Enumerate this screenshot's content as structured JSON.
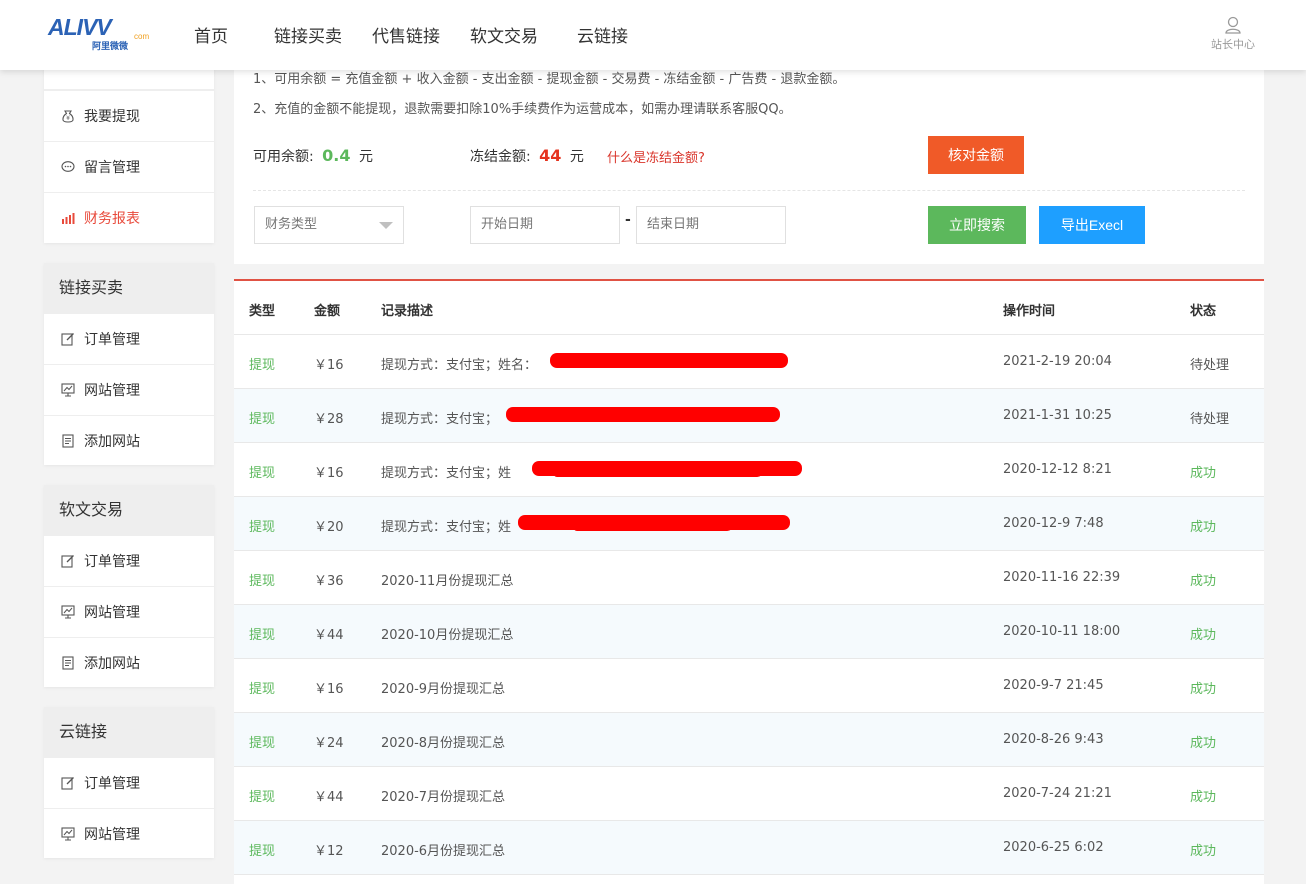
{
  "header": {
    "logo_text": "ALIVV",
    "logo_suffix": "com",
    "logo_cn": "阿里微微",
    "nav": [
      "首页",
      "链接买卖",
      "代售链接",
      "软文交易",
      "云链接"
    ],
    "user_label": "站长中心"
  },
  "sidebar": {
    "card1_items": [
      "我要提现",
      "留言管理",
      "财务报表"
    ],
    "groups": [
      {
        "title": "链接买卖",
        "items": [
          "订单管理",
          "网站管理",
          "添加网站"
        ]
      },
      {
        "title": "软文交易",
        "items": [
          "订单管理",
          "网站管理",
          "添加网站"
        ]
      },
      {
        "title": "云链接",
        "items": [
          "订单管理",
          "网站管理"
        ]
      }
    ]
  },
  "panel": {
    "note1": "1、可用余额 = 充值金额 + 收入金额 - 支出金额 - 提现金额 - 交易费 - 冻结金额 - 广告费 - 退款金额。",
    "note2": "2、充值的金额不能提现，退款需要扣除10%手续费作为运营成本，如需办理请联系客服QQ。",
    "available_label": "可用余额:",
    "available_value": "0.4",
    "frozen_label": "冻结金额:",
    "frozen_value": "44",
    "unit": "元",
    "frozen_link": "什么是冻结金额?",
    "check_button": "核对金额",
    "type_select": "财务类型",
    "start_date_placeholder": "开始日期",
    "end_date_placeholder": "结束日期",
    "date_separator": "-",
    "search_button": "立即搜索",
    "export_button": "导出Execl"
  },
  "table": {
    "headers": [
      "类型",
      "金额",
      "记录描述",
      "操作时间",
      "状态"
    ],
    "rows": [
      {
        "type": "提现",
        "amount": "￥16",
        "desc": "提现方式：支付宝；姓名：",
        "time": "2021-2-19 20:04",
        "status": "待处理"
      },
      {
        "type": "提现",
        "amount": "￥28",
        "desc": "提现方式：支付宝；",
        "time": "2021-1-31 10:25",
        "status": "待处理"
      },
      {
        "type": "提现",
        "amount": "￥16",
        "desc": "提现方式：支付宝；姓",
        "time": "2020-12-12 8:21",
        "status": "成功"
      },
      {
        "type": "提现",
        "amount": "￥20",
        "desc": "提现方式：支付宝；姓",
        "time": "2020-12-9 7:48",
        "status": "成功"
      },
      {
        "type": "提现",
        "amount": "￥36",
        "desc": "2020-11月份提现汇总",
        "time": "2020-11-16 22:39",
        "status": "成功"
      },
      {
        "type": "提现",
        "amount": "￥44",
        "desc": "2020-10月份提现汇总",
        "time": "2020-10-11 18:00",
        "status": "成功"
      },
      {
        "type": "提现",
        "amount": "￥16",
        "desc": "2020-9月份提现汇总",
        "time": "2020-9-7 21:45",
        "status": "成功"
      },
      {
        "type": "提现",
        "amount": "￥24",
        "desc": "2020-8月份提现汇总",
        "time": "2020-8-26 9:43",
        "status": "成功"
      },
      {
        "type": "提现",
        "amount": "￥44",
        "desc": "2020-7月份提现汇总",
        "time": "2020-7-24 21:21",
        "status": "成功"
      },
      {
        "type": "提现",
        "amount": "￥12",
        "desc": "2020-6月份提现汇总",
        "time": "2020-6-25 6:02",
        "status": "成功"
      }
    ]
  }
}
